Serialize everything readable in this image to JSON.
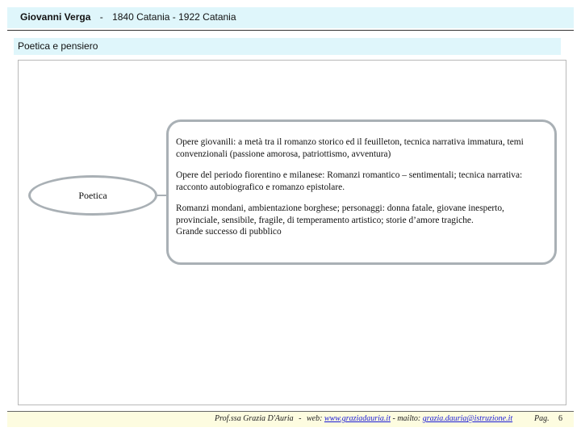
{
  "header": {
    "author": "Giovanni Verga",
    "separator": "-",
    "dates": "1840 Catania - 1922 Catania"
  },
  "section": {
    "title": "Poetica e pensiero"
  },
  "diagram": {
    "node_label": "Poetica",
    "paragraphs": [
      "Opere giovanili: a metà tra il romanzo storico ed il feuilleton, tecnica narrativa immatura, temi convenzionali (passione amorosa, patriottismo, avventura)",
      "Opere del periodo fiorentino e milanese: Romanzi romantico – sentimentali; tecnica narrativa: racconto autobiografico e romanzo epistolare.",
      "Romanzi mondani, ambientazione borghese; personaggi: donna fatale, giovane inesperto, provinciale, sensibile, fragile, di temperamento artistico; storie d’amore tragiche.",
      "Grande successo di pubblico"
    ]
  },
  "footer": {
    "credit": "Prof.ssa Grazia D'Auria",
    "sep1": "-",
    "web_label": "web:",
    "web_link": "www.graziadauria.it",
    "sep2": "- mailto:",
    "mail_link": "grazia.dauria@istruzione.it",
    "page_label": "Pag.",
    "page_number": "6"
  }
}
